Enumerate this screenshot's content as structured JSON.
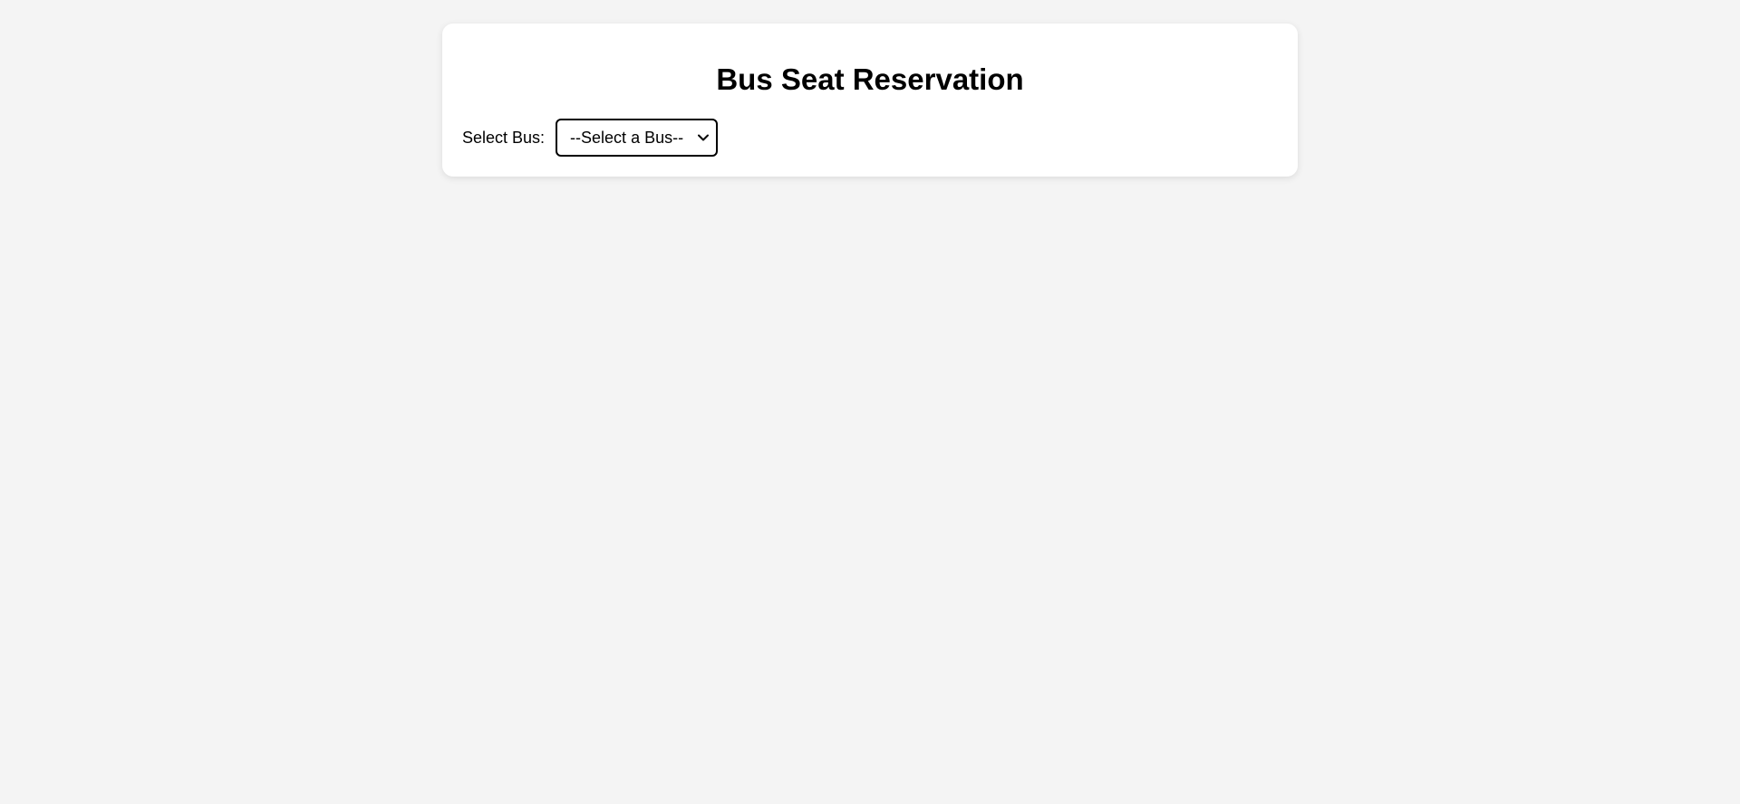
{
  "card": {
    "title": "Bus Seat Reservation"
  },
  "bus_selector": {
    "label": "Select Bus:",
    "selected": "--Select a Bus--",
    "icon": "chevron-down-icon"
  }
}
